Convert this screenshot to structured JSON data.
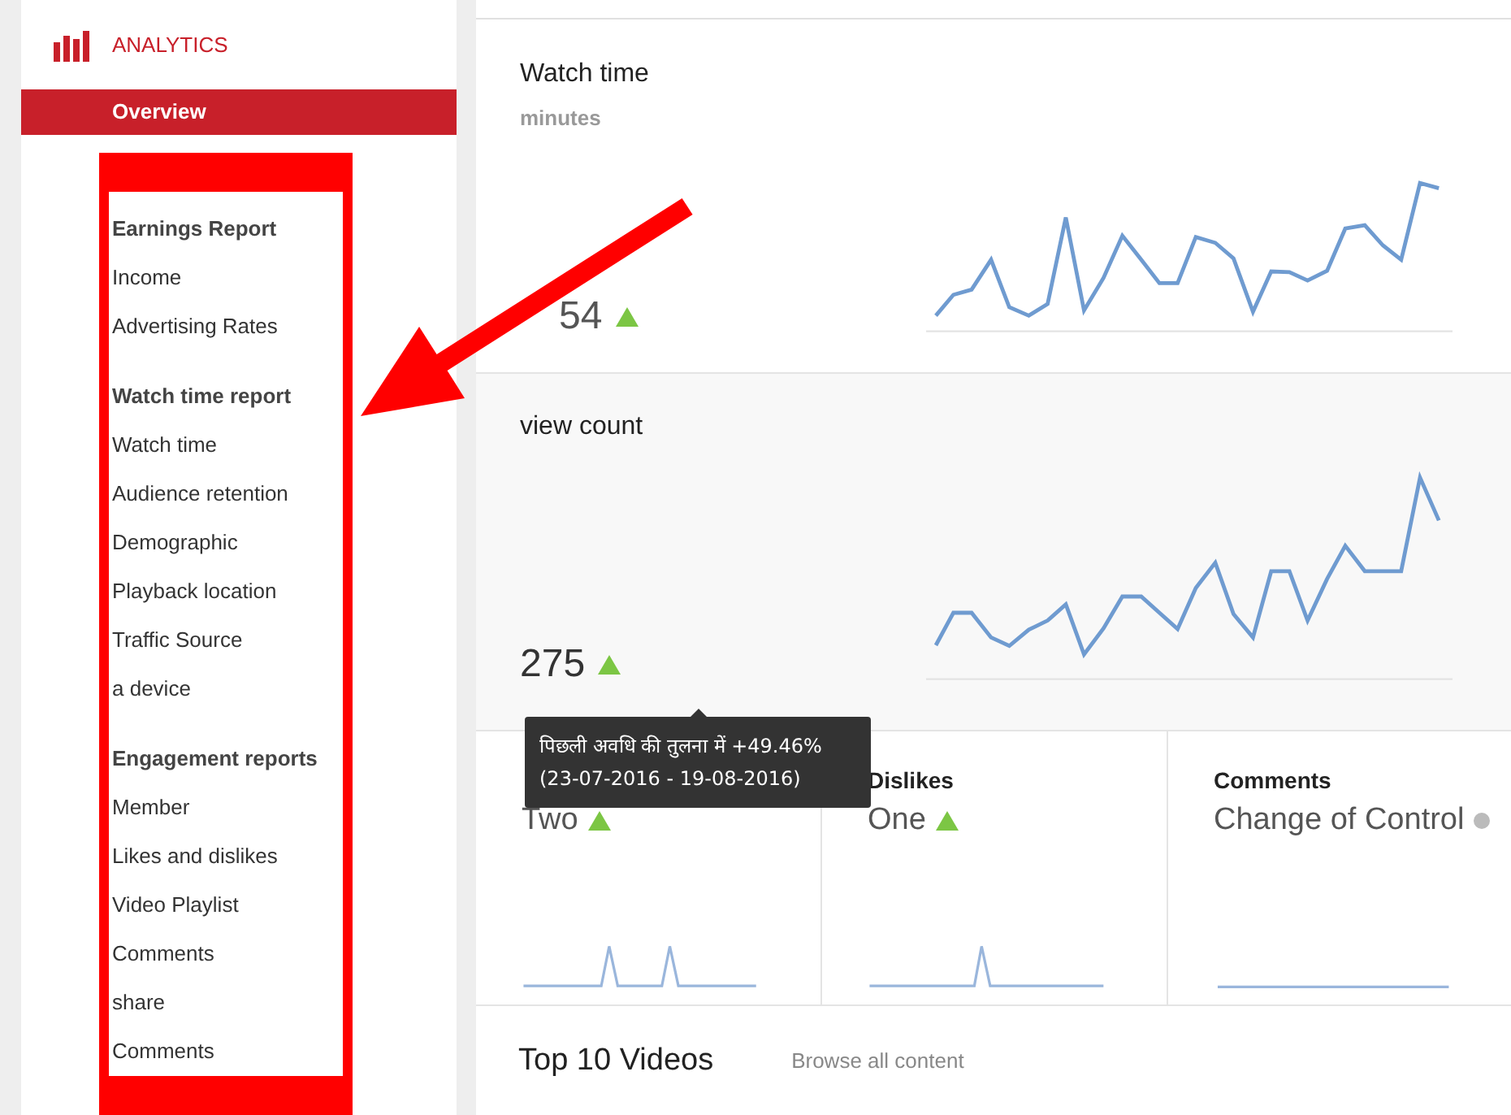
{
  "sidebar": {
    "title": "ANALYTICS",
    "items": [
      {
        "label": "Overview",
        "selected": true
      }
    ],
    "sections": [
      {
        "heading": "Earnings Report",
        "items": [
          {
            "label": "Income",
            "selected": false
          },
          {
            "label": "Advertising Rates",
            "selected": false
          }
        ]
      },
      {
        "heading": "Watch time report",
        "items": [
          {
            "label": "Watch time",
            "selected": false
          },
          {
            "label": "Audience retention",
            "selected": false
          },
          {
            "label": "Demographic",
            "selected": false
          },
          {
            "label": "Playback location",
            "selected": false
          },
          {
            "label": "Traffic Source",
            "selected": false
          },
          {
            "label": "a device",
            "selected": false
          }
        ]
      },
      {
        "heading": "Engagement reports",
        "items": [
          {
            "label": "Member",
            "selected": false
          },
          {
            "label": "Likes and dislikes",
            "selected": false
          },
          {
            "label": "Video Playlist",
            "selected": false
          },
          {
            "label": "Comments",
            "selected": false
          },
          {
            "label": "share",
            "selected": false
          },
          {
            "label": "Comments",
            "selected": false
          }
        ]
      }
    ]
  },
  "metrics": [
    {
      "title": "Watch time",
      "unit": "minutes",
      "value": "54",
      "rising": true
    },
    {
      "title": "view count",
      "value": "275",
      "rising": true
    }
  ],
  "small_metrics": [
    {
      "value": "Two",
      "rising": true
    },
    {
      "title": "Dislikes",
      "value": "One",
      "rising": true
    },
    {
      "title": "Comments",
      "value": "Change of Control",
      "rising": false
    }
  ],
  "tooltip": {
    "lines": [
      "पिछली अवधि की तुलना में +49.46%",
      "(23-07-2016 - 19-08-2016)"
    ]
  },
  "top_videos": {
    "title": "Top 10 Videos",
    "link": "Browse all content"
  }
}
